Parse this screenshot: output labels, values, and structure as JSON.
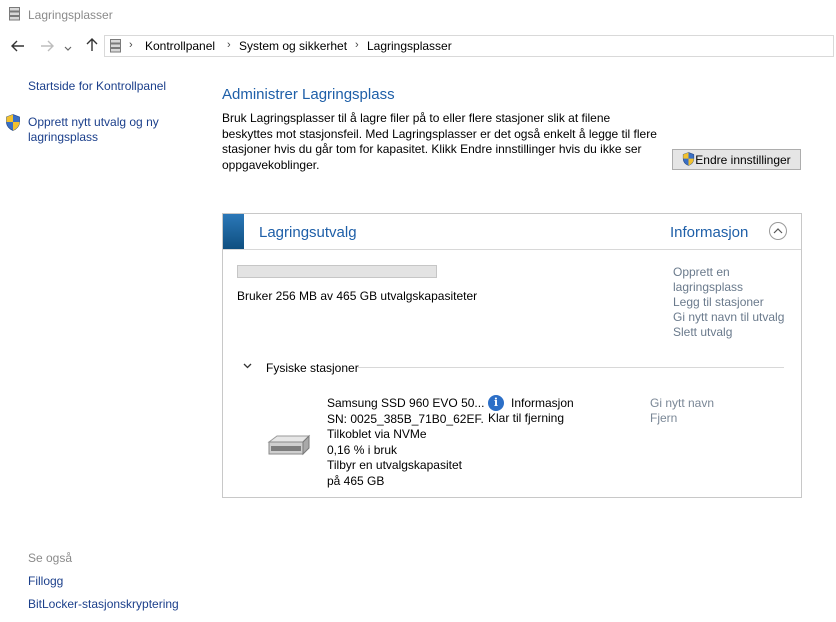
{
  "window": {
    "title": "Lagringsplasser"
  },
  "address": {
    "breadcrumbs": [
      "Kontrollpanel",
      "System og sikkerhet",
      "Lagringsplasser"
    ]
  },
  "left_pane": {
    "home_link": "Startside for Kontrollpanel",
    "create_link": "Opprett nytt utvalg og ny lagringsplass",
    "see_also_heading": "Se også",
    "see_also_links": [
      "Fillogg",
      "BitLocker-stasjonskryptering"
    ]
  },
  "main": {
    "title": "Administrer Lagringsplass",
    "description": "Bruk Lagringsplasser til å lagre filer på to eller flere stasjoner slik at filene beskyttes mot stasjonsfeil. Med Lagringsplasser er det også enkelt å legge til flere stasjoner hvis du går tom for kapasitet. Klikk Endre innstillinger hvis du ikke ser oppgavekoblinger.",
    "change_settings_button": "Endre innstillinger"
  },
  "pool": {
    "title": "Lagringsutvalg",
    "info_label": "Informasjon",
    "usage_fraction": 0.0005,
    "usage_text": "Bruker 256 MB av 465 GB utvalgskapasiteter",
    "actions": [
      "Opprett en lagringsplass",
      "Legg til stasjoner",
      "Gi nytt navn til utvalg",
      "Slett utvalg"
    ],
    "physical_section_label": "Fysiske stasjoner",
    "drive": {
      "name": "Samsung SSD 960 EVO 50...",
      "serial": "SN: 0025_385B_71B0_62EF.",
      "connection": "Tilkoblet via NVMe",
      "usage": "0,16 % i bruk",
      "capacity_line1": "Tilbyr en utvalgskapasitet",
      "capacity_line2": "på 465 GB",
      "status_title": "Informasjon",
      "status_detail": "Klar til fjerning",
      "actions": [
        "Gi nytt navn",
        "Fjern"
      ]
    }
  },
  "colors": {
    "link": "#1b3f8b",
    "heading": "#1e5fa8",
    "accent": "#2b78b8"
  }
}
